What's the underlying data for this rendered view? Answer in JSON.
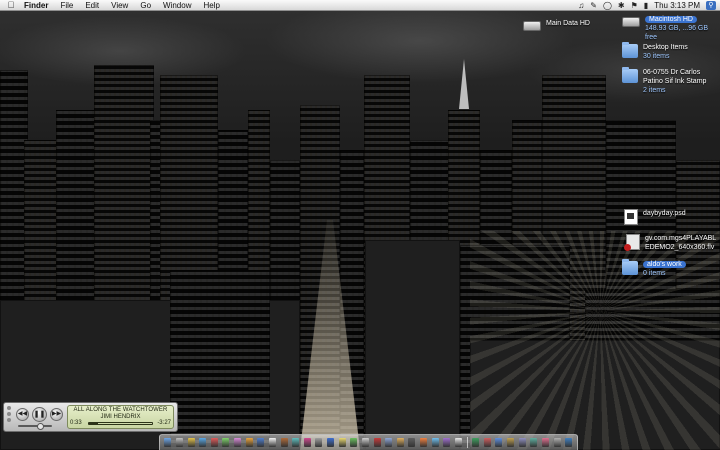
{
  "menubar": {
    "app_name": "Finder",
    "menus": [
      "File",
      "Edit",
      "View",
      "Go",
      "Window",
      "Help"
    ],
    "status_icons": [
      "speaker-icon",
      "evernote-icon",
      "airport-icon",
      "bluetooth-icon",
      "flag-icon",
      "battery-icon"
    ],
    "clock": "Thu 3:13 PM"
  },
  "desktop": {
    "main_data_hd": {
      "name": "Main Data HD"
    },
    "macintosh_hd": {
      "name": "Macintosh HD",
      "info": "148.93 GB, ...96 GB free"
    },
    "desktop_items": {
      "name": "Desktop Items",
      "info": "30 items"
    },
    "dr_carlos": {
      "name_line1": "06-0755 Dr Carlos",
      "name_line2": "Patino Sif Ink Stamp",
      "info": "2 items"
    },
    "daybyday": {
      "name": "daybyday.psd"
    },
    "flv_file": {
      "name_line1": "gv.com.mgs4PLAYABL",
      "name_line2": "EDEMO2_640x360.flv"
    },
    "aldos_work": {
      "name": "aldo's work",
      "info": "0 items"
    }
  },
  "player": {
    "song": "ALL ALONG THE WATCHTOWER",
    "artist": "JIMI HENDRIX",
    "elapsed": "0:33",
    "remaining": "-3:27",
    "progress": 0.14,
    "volume": 0.65
  },
  "dock": {
    "icon_colors": [
      "#6fa8e8",
      "#c0c0c0",
      "#e2c24a",
      "#5aa9e6",
      "#e05a5a",
      "#7fd36b",
      "#d88cd8",
      "#e8a23c",
      "#4f7fcf",
      "#f2f2f2",
      "#b06b3a",
      "#5fbfbf",
      "#d04a8f",
      "#9f9f9f",
      "#3f6fd0",
      "#e8d870",
      "#6abf5e",
      "#d0d0d0",
      "#c83c3c",
      "#8fa8d8",
      "#e0b060",
      "#5f5f5f",
      "#f08040",
      "#70c0f0",
      "#a070d0",
      "#e8e8e8",
      "#3fa060",
      "#d06060",
      "#6090e0",
      "#c0a050",
      "#9090c0",
      "#60b0a0",
      "#e07090",
      "#b0b0b0",
      "#4080c0"
    ],
    "separator_after": 26
  }
}
